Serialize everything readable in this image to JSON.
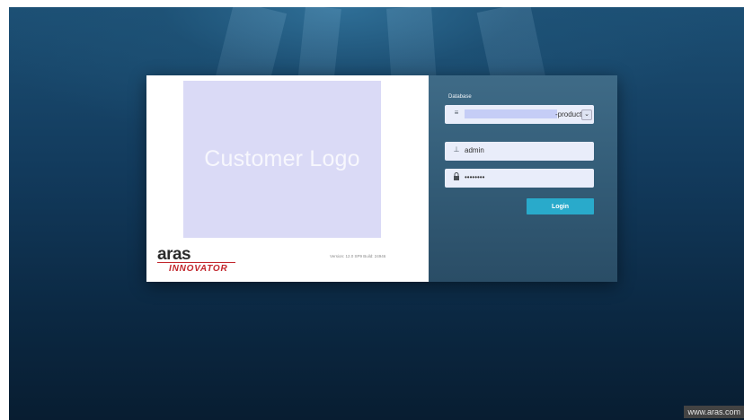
{
  "logo": {
    "placeholder_text": "Customer Logo"
  },
  "brand": {
    "name": "aras",
    "product": "INNOVATOR",
    "version": "Version: 12.0 SP9 Build: 24946"
  },
  "login": {
    "database_label": "Database",
    "database_value": "-producti",
    "username": "admin",
    "password_masked": "••••••••",
    "login_button": "Login"
  },
  "footer": {
    "url": "www.aras.com"
  },
  "icons": {
    "database": "list-icon",
    "dropdown": "chevron-down-icon",
    "username": "user-icon",
    "password": "lock-icon"
  },
  "colors": {
    "background": "#123a5c",
    "logo_box": "#dadaf6",
    "login_panel": "#335c77",
    "login_button": "#29aacb",
    "brand_red": "#c2272d"
  }
}
